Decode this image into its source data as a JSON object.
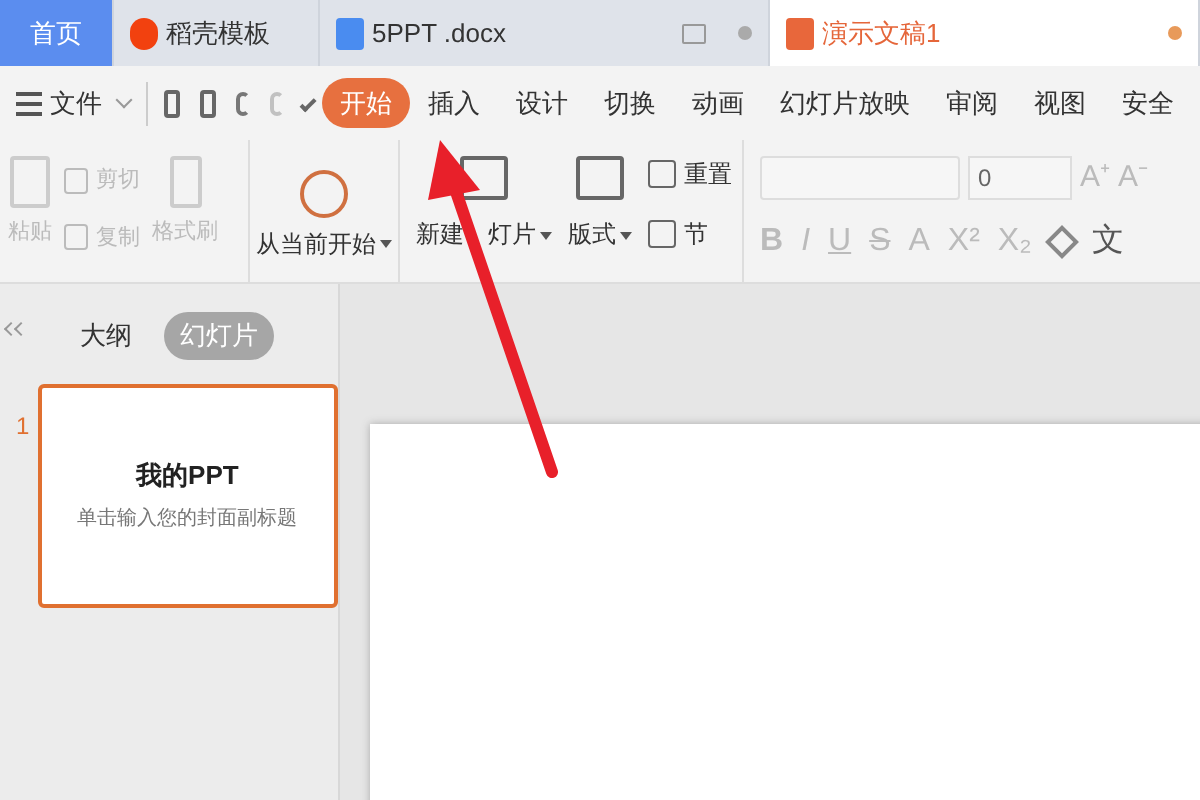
{
  "tabs": [
    {
      "label": "首页",
      "kind": "home",
      "selected": false
    },
    {
      "label": "稻壳模板",
      "kind": "docer",
      "selected": false
    },
    {
      "label": "5PPT .docx",
      "kind": "word",
      "selected": false
    },
    {
      "label": "演示文稿1",
      "kind": "ppt",
      "selected": true
    }
  ],
  "file_menu": "文件",
  "menu": [
    {
      "label": "开始",
      "selected": true
    },
    {
      "label": "插入",
      "selected": false
    },
    {
      "label": "设计",
      "selected": false
    },
    {
      "label": "切换",
      "selected": false
    },
    {
      "label": "动画",
      "selected": false
    },
    {
      "label": "幻灯片放映",
      "selected": false
    },
    {
      "label": "审阅",
      "selected": false
    },
    {
      "label": "视图",
      "selected": false
    },
    {
      "label": "安全",
      "selected": false
    }
  ],
  "clipboard": {
    "paste": {
      "label": "粘贴",
      "disabled": true
    },
    "cut": {
      "label": "剪切",
      "disabled": true
    },
    "copy": {
      "label": "复制",
      "disabled": true
    },
    "format_painter": {
      "label": "格式刷",
      "disabled": true
    }
  },
  "play_from_current": "从当前开始",
  "new_slide_parts": [
    "新建",
    "灯片"
  ],
  "layout": "版式",
  "reset": "重置",
  "section": "节",
  "font_size": "0",
  "font_size_buttons": [
    "A⁺",
    "A⁻"
  ],
  "format_buttons": [
    {
      "symbol": "B",
      "kind": "bold"
    },
    {
      "symbol": "I",
      "kind": "italic"
    },
    {
      "symbol": "U",
      "kind": "underline"
    },
    {
      "symbol": "S",
      "kind": "strike"
    },
    {
      "symbol": "A",
      "kind": "color"
    },
    {
      "symbol": "X²",
      "kind": "sup"
    },
    {
      "symbol": "X₂",
      "kind": "sub"
    },
    {
      "symbol": "文",
      "kind": "phonetic"
    }
  ],
  "panel_tabs": [
    {
      "label": "大纲",
      "selected": false
    },
    {
      "label": "幻灯片",
      "selected": true
    }
  ],
  "slides": [
    {
      "number": "1",
      "title": "我的PPT",
      "subtitle": "单击输入您的封面副标题",
      "selected": true
    }
  ]
}
